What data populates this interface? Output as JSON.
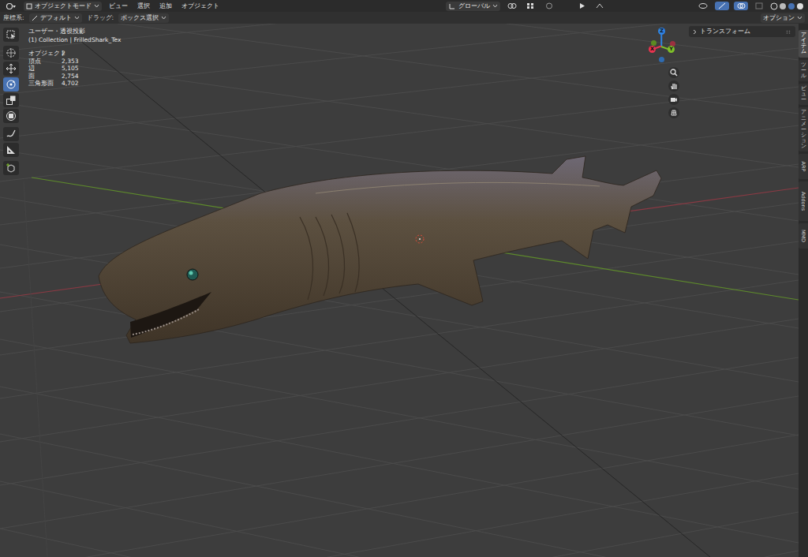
{
  "header": {
    "mode": "オブジェクトモード",
    "menus": [
      "ビュー",
      "選択",
      "追加",
      "オブジェクト"
    ],
    "transform_orientation": "グローバル"
  },
  "tool_settings": {
    "orientation_label": "座標系:",
    "orientation": "デフォルト",
    "drag_label": "ドラッグ:",
    "drag": "ボックス選択",
    "options": "オプション"
  },
  "toolbar": [
    {
      "kind": "select-box",
      "selected": false
    },
    {
      "kind": "cursor",
      "selected": false
    },
    {
      "kind": "move",
      "selected": false
    },
    {
      "kind": "rotate",
      "selected": true
    },
    {
      "kind": "scale",
      "selected": false
    },
    {
      "kind": "transform",
      "selected": false
    },
    {
      "kind": "annotate",
      "selected": false
    },
    {
      "kind": "measure",
      "selected": false
    },
    {
      "kind": "add-cube",
      "selected": false
    }
  ],
  "viewport": {
    "view_name": "ユーザー・透視投影",
    "collection": "(1) Collection | FrilledShark_Tex",
    "stats": [
      {
        "label": "オブジェクト",
        "value": "2"
      },
      {
        "label": "頂点",
        "value": "2,353"
      },
      {
        "label": "辺",
        "value": "5,105"
      },
      {
        "label": "面",
        "value": "2,754"
      },
      {
        "label": "三角形面",
        "value": "4,702"
      }
    ]
  },
  "gizmo": {
    "axes": [
      {
        "label": "Z",
        "color": "#2f83e4"
      },
      {
        "label": "X",
        "color": "#e8344f"
      },
      {
        "label": "Y",
        "color": "#7fbf2a"
      }
    ],
    "negative_axes": [
      {
        "color": "#2f6bb0"
      },
      {
        "color": "#9b3040"
      },
      {
        "color": "#5b8a22"
      }
    ]
  },
  "sidebar": {
    "panels": [
      {
        "label": "トランスフォーム",
        "expanded": false
      }
    ],
    "tabs": [
      {
        "label": "アイテム",
        "kind": "cjk",
        "selected": true
      },
      {
        "label": "ツール",
        "kind": "cjk",
        "selected": false
      },
      {
        "label": "ビュー",
        "kind": "cjk",
        "selected": false
      },
      {
        "label": "アニメーション",
        "kind": "cjk",
        "selected": false
      },
      {
        "label": "ARP",
        "kind": "latin",
        "selected": false
      },
      {
        "label": "Addons",
        "kind": "latin",
        "selected": false
      },
      {
        "label": "MMD",
        "kind": "latin",
        "selected": false
      }
    ]
  }
}
